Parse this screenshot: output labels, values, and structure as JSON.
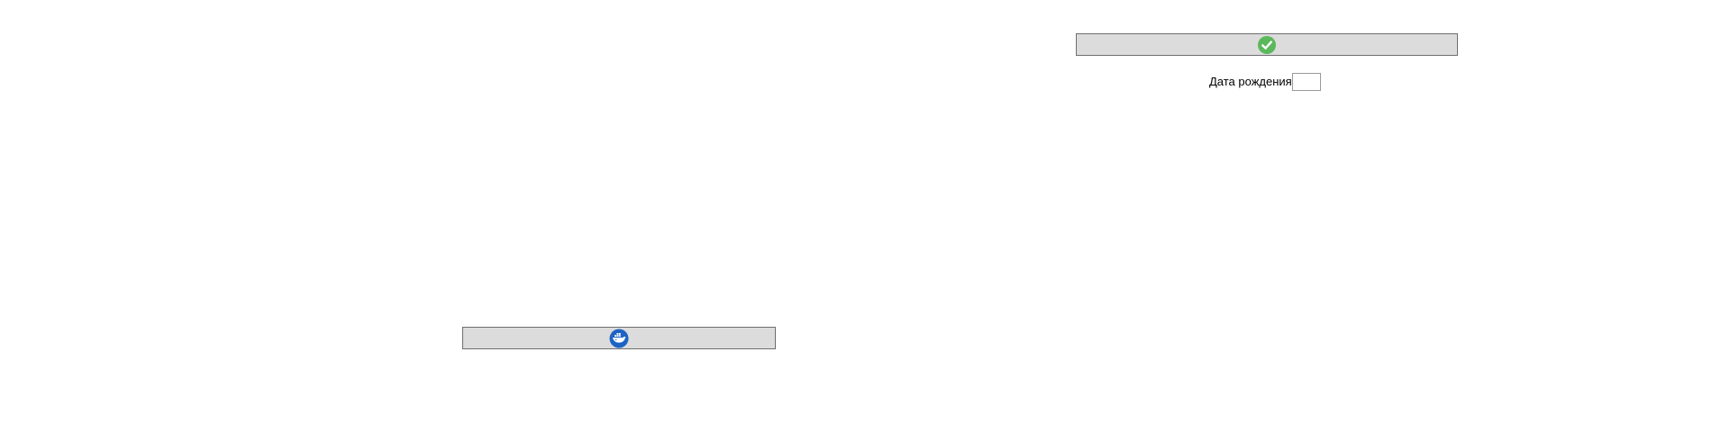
{
  "confirm_bar": {
    "icon": "check-circle-icon",
    "icon_color": "#5cb85c"
  },
  "birth_date": {
    "label": "Дата рождения",
    "value": ""
  },
  "docker_bar": {
    "icon": "docker-whale-icon",
    "icon_color": "#1d63c4"
  }
}
